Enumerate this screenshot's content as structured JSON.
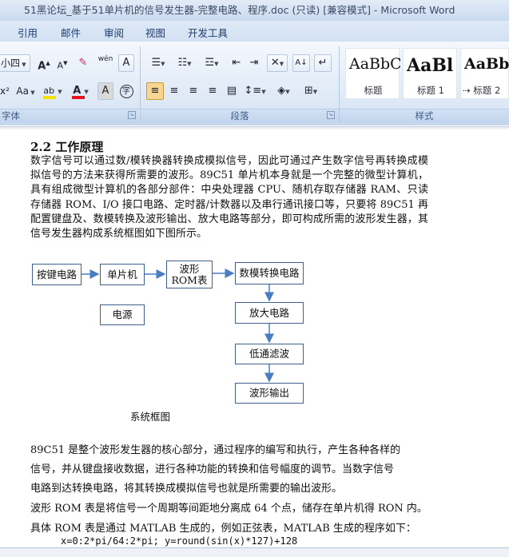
{
  "window": {
    "title": "51黑论坛_基于51单片机的信号发生器-完整电路、程序.doc (只读) [兼容模式] - Microsoft Word"
  },
  "tabs": [
    "引用",
    "邮件",
    "审阅",
    "视图",
    "开发工具"
  ],
  "ribbon": {
    "font_group": {
      "label": "字体",
      "size_value": "小四",
      "change_case": "Aa",
      "grow_font": "A",
      "shrink_font": "A",
      "phonetic": "wén",
      "char_border": "A",
      "char_shading": "A",
      "enclose": "字",
      "superscript": "x²",
      "highlight_color": "#f5e000",
      "font_color": "#e8141a"
    },
    "paragraph_group": {
      "label": "段落"
    },
    "styles_group": {
      "label": "样式",
      "styles": [
        {
          "sample": "AaBbC",
          "name": "标题"
        },
        {
          "sample": "AaBl",
          "name": "标题 1"
        },
        {
          "sample": "AaBb",
          "name": "标题 2"
        }
      ]
    }
  },
  "document": {
    "heading": "2.2 工作原理",
    "paragraph1": "数字信号可以通过数/模转换器转换成模拟信号，因此可通过产生数字信号再转换成模拟信号的方法来获得所需要的波形。89C51 单片机本身就是一个完整的微型计算机，具有组成微型计算机的各部分部件：中央处理器 CPU、随机存取存储器 RAM、只读存储器 ROM、I/O 接口电路、定时器/计数器以及串行通讯接口等，只要将 89C51 再配置键盘及、数模转换及波形输出、放大电路等部分，即可构成所需的波形发生器，其信号发生器构成系统框图如下图所示。",
    "diagram": {
      "blocks": {
        "keypad": "按键电路",
        "mcu": "单片机",
        "rom_line1": "波形",
        "rom_line2": "ROM表",
        "dac": "数模转换电路",
        "power": "电源",
        "amp": "放大电路",
        "lpf": "低通滤波",
        "output": "波形输出"
      },
      "caption": "系统框图"
    },
    "para2_lines": [
      "89C51 是整个波形发生器的核心部分，通过程序的编写和执行，产生各种各样的",
      "信号，并从键盘接收数据，进行各种功能的转换和信号幅度的调节。当数字信号",
      "电路到达转换电路，将其转换成模拟信号也就是所需要的输出波形。",
      "波形 ROM 表是将信号一个周期等间距地分离成 64 个点，储存在单片机得 RON 内。",
      "具体 ROM 表是通过 MATLAB 生成的，例如正弦表，MATLAB 生成的程序如下：",
      "x=0:2*pi/64:2*pi; y=round(sin(x)*127)+128"
    ]
  }
}
